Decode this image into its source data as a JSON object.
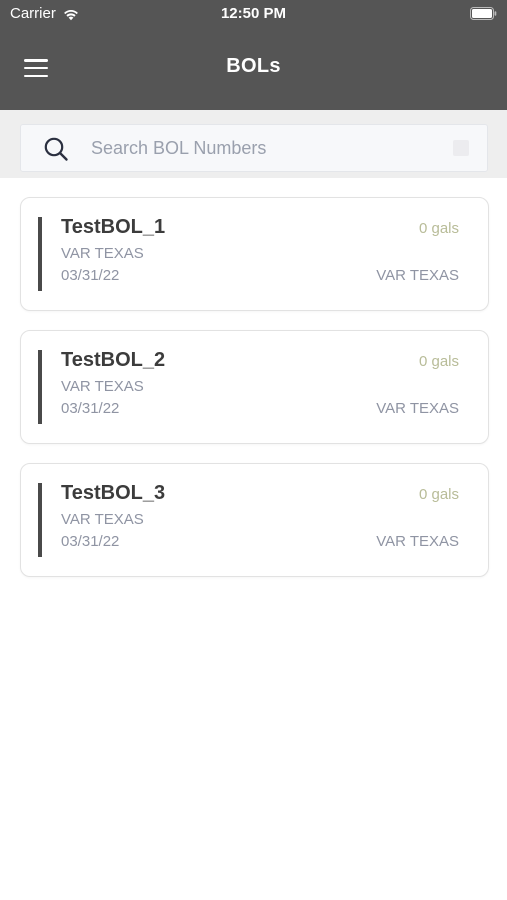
{
  "status_bar": {
    "carrier": "Carrier",
    "time": "12:50 PM",
    "wifi_icon": "wifi-icon",
    "battery_icon": "battery-icon"
  },
  "nav": {
    "title": "BOLs",
    "menu_icon": "hamburger-menu-icon"
  },
  "search": {
    "placeholder": "Search BOL Numbers",
    "value": "",
    "icon": "search-icon"
  },
  "colors": {
    "header_bg": "#555555",
    "search_band_bg": "#eeeeee",
    "accent_bar": "#4a4a4a",
    "qty_text": "#b8bc98",
    "muted_text": "#8f94a3"
  },
  "bols": [
    {
      "number": "TestBOL_1",
      "quantity": "0 gals",
      "subtitle": "VAR TEXAS",
      "date": "03/31/22",
      "location": "VAR TEXAS"
    },
    {
      "number": "TestBOL_2",
      "quantity": "0 gals",
      "subtitle": "VAR TEXAS",
      "date": "03/31/22",
      "location": "VAR TEXAS"
    },
    {
      "number": "TestBOL_3",
      "quantity": "0 gals",
      "subtitle": "VAR TEXAS",
      "date": "03/31/22",
      "location": "VAR TEXAS"
    }
  ]
}
